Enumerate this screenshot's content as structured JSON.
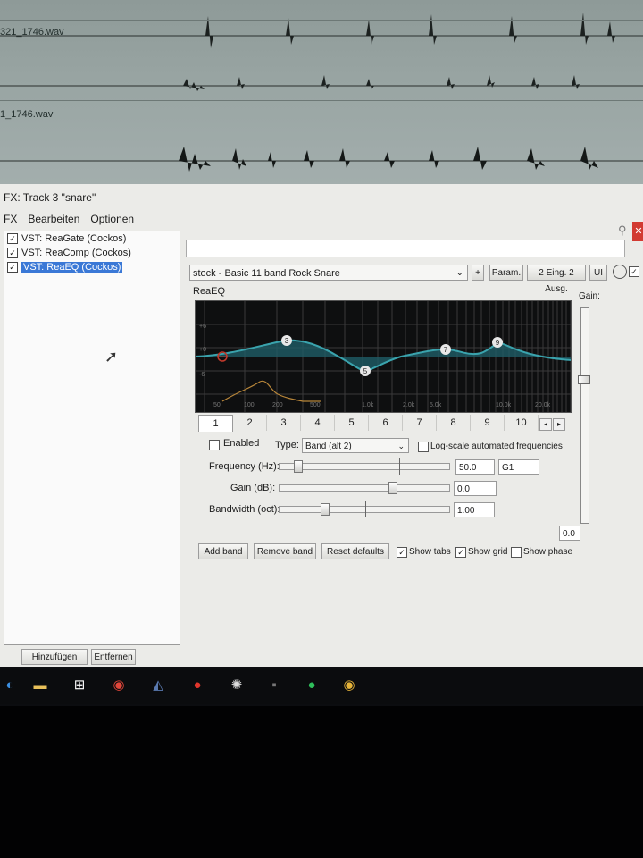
{
  "daw": {
    "tracks": [
      {
        "file_label": "321_1746.wav"
      },
      {
        "file_label": "1_1746.wav"
      }
    ]
  },
  "fx_window": {
    "title": "FX: Track 3 \"snare\"",
    "menu": [
      "FX",
      "Bearbeiten",
      "Optionen"
    ],
    "plugins": [
      {
        "label": "VST: ReaGate (Cockos)",
        "enabled": true,
        "selected": false
      },
      {
        "label": "VST: ReaComp (Cockos)",
        "enabled": true,
        "selected": false
      },
      {
        "label": "VST: ReaEQ (Cockos)",
        "enabled": true,
        "selected": true
      }
    ],
    "add_button": "Hinzufügen",
    "remove_button": "Entfernen",
    "preset": "stock - Basic 11 band Rock Snare",
    "plus_label": "+",
    "param_label": "Param.",
    "io_label": "2 Eing. 2 Ausg.",
    "ui_label": "UI",
    "plugin_title": "ReaEQ",
    "gain_label": "Gain:",
    "gain_value": "0.0",
    "gain_level_fraction": 0.5,
    "graph": {
      "db_labels": [
        "+6",
        "+0",
        "-6"
      ],
      "freq_labels": [
        "50",
        "100",
        "200",
        "500",
        "1.0k",
        "2.0k",
        "5.0k",
        "10.0k",
        "20.0k"
      ],
      "band_nodes": [
        "3",
        "5",
        "7",
        "9"
      ],
      "colors": {
        "curve": "#3aa3ad",
        "fill": "#1f5d66",
        "spectrum": "#b8863a",
        "grid": "#3a3a3a"
      }
    },
    "band_tabs": [
      "1",
      "2",
      "3",
      "4",
      "5",
      "6",
      "7",
      "8",
      "9",
      "10"
    ],
    "active_tab": "1",
    "enabled_label": "Enabled",
    "enabled_checked": false,
    "type_label": "Type:",
    "type_value": "Band (alt 2)",
    "logscale_label": "Log-scale automated frequencies",
    "logscale_checked": false,
    "frequency": {
      "label": "Frequency (Hz):",
      "value": "50.0",
      "note": "G1"
    },
    "gain": {
      "label": "Gain (dB):",
      "value": "0.0"
    },
    "bandwidth": {
      "label": "Bandwidth (oct):",
      "value": "1.00"
    },
    "buttons": {
      "add_band": "Add band",
      "remove_band": "Remove band",
      "reset_defaults": "Reset defaults"
    },
    "show_tabs": {
      "label": "Show tabs",
      "checked": true
    },
    "show_grid": {
      "label": "Show grid",
      "checked": true
    },
    "show_phase": {
      "label": "Show phase",
      "checked": false
    }
  },
  "taskbar": {
    "icons": [
      "windows-start-icon",
      "file-explorer-icon",
      "windows-store-icon",
      "chrome-icon",
      "steam-icon",
      "media-player-icon",
      "reaper-icon",
      "app-icon",
      "spotify-icon",
      "chrome-active-icon"
    ]
  }
}
